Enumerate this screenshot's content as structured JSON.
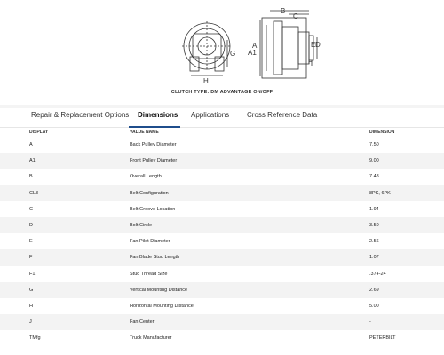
{
  "diagram": {
    "caption": "CLUTCH TYPE: DM ADVANTAGE ON/OFF",
    "labels": {
      "A": "A",
      "A1": "A1",
      "B": "B",
      "C": "C",
      "D": "D",
      "E": "E",
      "F": "F",
      "G": "G",
      "H": "H"
    }
  },
  "tabs": [
    {
      "label": "Repair & Replacement Options"
    },
    {
      "label": "Dimensions"
    },
    {
      "label": "Applications"
    },
    {
      "label": "Cross Reference Data"
    }
  ],
  "table": {
    "headers": {
      "display": "DISPLAY",
      "name": "VALUE NAME",
      "dimension": "DIMENSION"
    },
    "rows": [
      {
        "display": "A",
        "name": "Back Pulley Diameter",
        "value": "7.50"
      },
      {
        "display": "A1",
        "name": "Front Pulley Diameter",
        "value": "9.00"
      },
      {
        "display": "B",
        "name": "Overall Length",
        "value": "7.48"
      },
      {
        "display": "CL3",
        "name": "Belt Configuration",
        "value": "8PK, 6PK"
      },
      {
        "display": "C",
        "name": "Belt Groove Location",
        "value": "1.94"
      },
      {
        "display": "D",
        "name": "Bolt Circle",
        "value": "3.50"
      },
      {
        "display": "E",
        "name": "Fan Pilot Diameter",
        "value": "2.56"
      },
      {
        "display": "F",
        "name": "Fan Blade Stud Length",
        "value": "1.07"
      },
      {
        "display": "F1",
        "name": "Stud Thread Size",
        "value": ".374-24"
      },
      {
        "display": "G",
        "name": "Vertical Mounting Distance",
        "value": "2.69"
      },
      {
        "display": "H",
        "name": "Horizontal Mounting Distance",
        "value": "5.00"
      },
      {
        "display": "J",
        "name": "Fan Center",
        "value": "-"
      },
      {
        "display": "TMfg",
        "name": "Truck Manufacturer",
        "value": "PETERBILT"
      }
    ]
  }
}
